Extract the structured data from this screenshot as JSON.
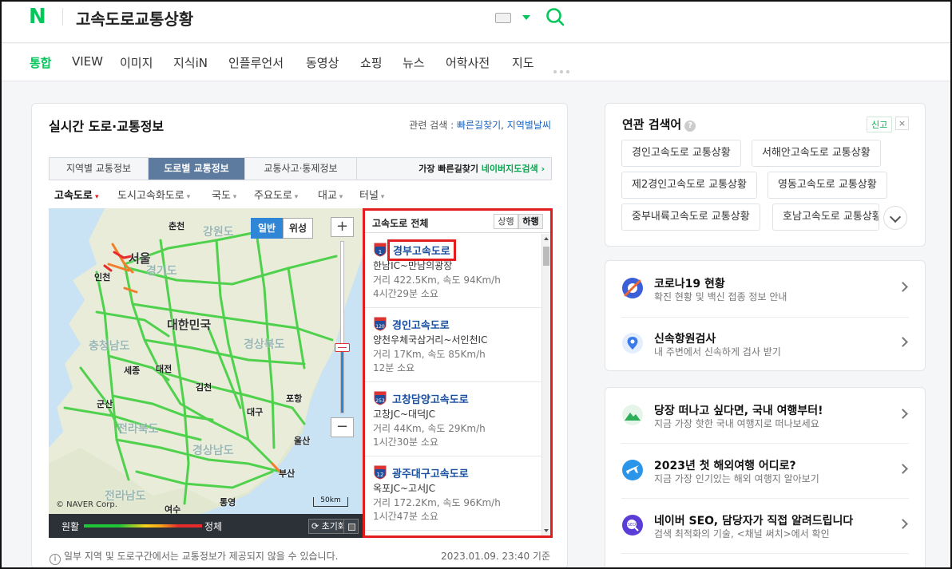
{
  "header": {
    "query": "고속도로교통상황",
    "logo_text": "N"
  },
  "tabs": [
    "통합",
    "VIEW",
    "이미지",
    "지식iN",
    "인플루언서",
    "동영상",
    "쇼핑",
    "뉴스",
    "어학사전",
    "지도"
  ],
  "main": {
    "title": "실시간 도로·교통정보",
    "related_label": "관련 검색 :",
    "related_links": [
      "빠른길찾기",
      "지역별날씨"
    ],
    "subtabs": [
      "지역별 교통정보",
      "도로별 교통정보",
      "교통사고·통제정보"
    ],
    "subtab_right_prefix": "가장 빠른길찾기",
    "subtab_right_link": "네이버지도검색 ›",
    "filters": [
      "고속도로",
      "도시고속화도로",
      "국도",
      "주요도로",
      "대교",
      "터널"
    ],
    "map": {
      "mode_buttons": [
        "일반",
        "위성"
      ],
      "zoom_in": "+",
      "zoom_out": "−",
      "zoom_level_fraction": 0.38,
      "scale_label": "50km",
      "copyright": "© NAVER Corp.",
      "labels": {
        "seoul": "서울",
        "incheon": "인천",
        "chuncheon": "춘천",
        "gangwon": "강원도",
        "gyeonggi": "경기도",
        "korea": "대한민국",
        "chungnam": "충청남도",
        "gyeongbuk": "경상북도",
        "sejong": "세종",
        "daejeon": "대전",
        "gimcheon": "김천",
        "pohang": "포항",
        "gunsan": "군산",
        "daegu": "대구",
        "jeonbuk": "전라북도",
        "gyeongnam": "경상남도",
        "ulsan": "울산",
        "busan": "부산",
        "jeonnam": "전라남도",
        "yeosu": "여수",
        "tongyeong": "통영"
      }
    },
    "legend": {
      "left": "원활",
      "right": "정체",
      "reset": "초기화"
    },
    "list": {
      "title": "고속도로 전체",
      "dir_options": [
        "상행",
        "하행"
      ],
      "dir_selected": "하행",
      "roads": [
        {
          "no": "1",
          "name": "경부고속도로",
          "section": "한남IC~만남의광장",
          "info": "거리 422.5Km, 속도 94Km/h",
          "time": "4시간29분 소요"
        },
        {
          "no": "120",
          "name": "경인고속도로",
          "section": "양천우체국삼거리~서인천IC",
          "info": "거리 17Km, 속도 85Km/h",
          "time": "12분 소요"
        },
        {
          "no": "253",
          "name": "고창담양고속도로",
          "section": "고창JC~대덕JC",
          "info": "거리 44Km, 속도 29Km/h",
          "time": "1시간30분 소요"
        },
        {
          "no": "12",
          "name": "광주대구고속도로",
          "section": "옥포JC~고서JC",
          "info": "거리 172.2Km, 속도 96Km/h",
          "time": "1시간47분 소요"
        }
      ]
    },
    "notice_icon": "i",
    "notice": "일부 지역 및 도로구간에서는 교통정보가 제공되지 않을 수 있습니다.",
    "timestamp": "2023.01.09. 23:40 기준"
  },
  "related": {
    "title": "연관 검색어",
    "help": "?",
    "report": "신고",
    "close": "×",
    "chips": [
      "경인고속도로 교통상황",
      "서해안고속도로 교통상황",
      "제2경인고속도로 교통상황",
      "영동고속도로 교통상황",
      "중부내륙고속도로 교통상황",
      "호남고속도로 교통상황"
    ]
  },
  "cards": [
    [
      {
        "title": "코로나19 현황",
        "sub": "확진 현황 및 백신 접종 정보 안내",
        "icon": "covid-icon"
      },
      {
        "title": "신속항원검사",
        "sub": "내 주변에서 신속하게 검사 받기",
        "icon": "map-pin-icon"
      }
    ],
    [
      {
        "title": "당장 떠나고 싶다면, 국내 여행부터!",
        "sub": "지금 가장 핫한 국내 여행지로 떠나보세요",
        "icon": "mountain-icon"
      },
      {
        "title": "2023년 첫 해외여행 어디로?",
        "sub": "지금 가장 인기있는 해외 여행지 알아보기",
        "icon": "airplane-icon"
      },
      {
        "title": "네이버 SEO, 담당자가 직접 알려드립니다",
        "sub": "검색 최적화의 기술, <채널 써치>에서 확인",
        "icon": "seo-icon"
      }
    ]
  ],
  "colors": {
    "brand": "#03c75a",
    "highlight": "#e31d1d",
    "tab_active": "#5d7b9e",
    "link": "#1a4fa0"
  }
}
